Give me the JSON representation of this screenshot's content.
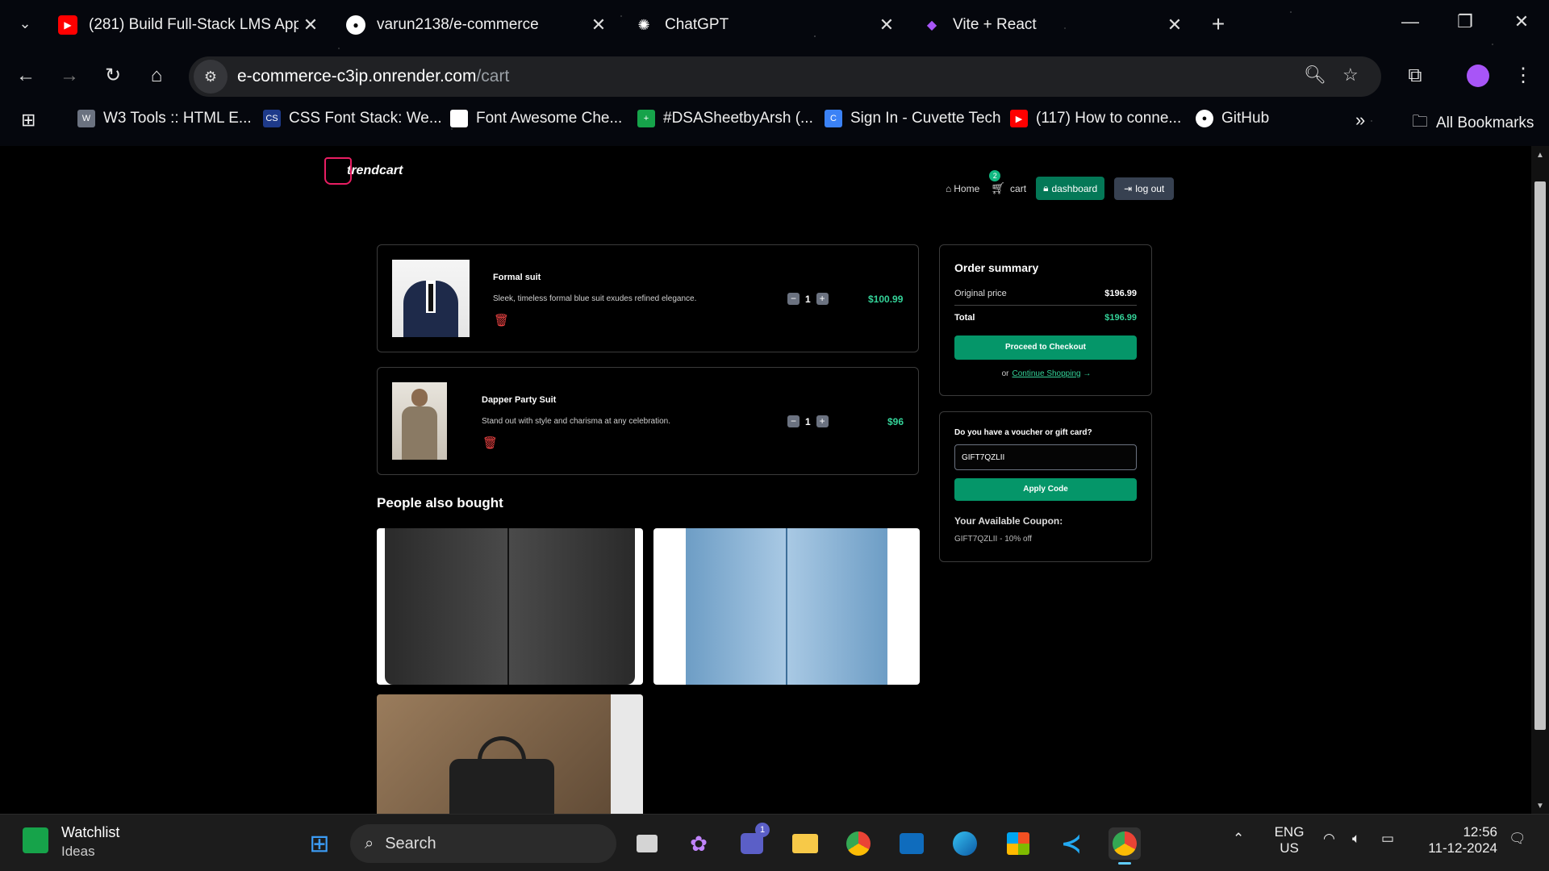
{
  "browser": {
    "tabs": [
      {
        "title": "(281) Build Full-Stack LMS App",
        "icon": "youtube-icon",
        "color": "#ff0000"
      },
      {
        "title": "varun2138/e-commerce",
        "icon": "github-icon",
        "color": "#ffffff"
      },
      {
        "title": "ChatGPT",
        "icon": "chatgpt-icon",
        "color": "#ffffff"
      },
      {
        "title": "Vite + React",
        "icon": "vite-icon",
        "color": "#a855f7"
      }
    ],
    "url_host": "e-commerce-c3ip.onrender.com",
    "url_path": "/cart",
    "bookmarks": [
      {
        "label": "W3 Tools :: HTML E..."
      },
      {
        "label": "CSS Font Stack: We..."
      },
      {
        "label": "Font Awesome Che..."
      },
      {
        "label": "#DSASheetbyArsh (..."
      },
      {
        "label": "Sign In - Cuvette Tech"
      },
      {
        "label": "(117) How to conne..."
      },
      {
        "label": "GitHub"
      }
    ],
    "all_bookmarks": "All Bookmarks",
    "bookmark_more": "»"
  },
  "site": {
    "logo_text": "trendcart",
    "nav": {
      "home": "Home",
      "cart": "cart",
      "cart_count": "2",
      "dashboard": "dashboard",
      "logout": "log out"
    }
  },
  "cart": {
    "items": [
      {
        "name": "Formal suit",
        "description": "Sleek, timeless formal blue suit exudes refined elegance.",
        "quantity": "1",
        "price": "$100.99"
      },
      {
        "name": "Dapper Party Suit",
        "description": "Stand out with style and charisma at any celebration.",
        "quantity": "1",
        "price": "$96"
      }
    ]
  },
  "recommendations": {
    "title": "People also bought"
  },
  "summary": {
    "title": "Order summary",
    "original_label": "Original price",
    "original_value": "$196.99",
    "total_label": "Total",
    "total_value": "$196.99",
    "checkout": "Proceed to Checkout",
    "or": "or",
    "continue": "Continue Shopping",
    "continue_arrow": "→"
  },
  "voucher": {
    "label": "Do you have a voucher or gift card?",
    "value": "GIFT7QZLII",
    "apply": "Apply Code",
    "available_title": "Your Available Coupon:",
    "available_coupon": "GIFT7QZLII - 10% off"
  },
  "taskbar": {
    "widget_title": "Watchlist",
    "widget_sub": "Ideas",
    "search": "Search",
    "teams_badge": "1",
    "lang_top": "ENG",
    "lang_bottom": "US",
    "time": "12:56",
    "date": "11-12-2024"
  },
  "colors": {
    "accent": "#059669",
    "price": "#34d399",
    "danger": "#ef4444"
  }
}
